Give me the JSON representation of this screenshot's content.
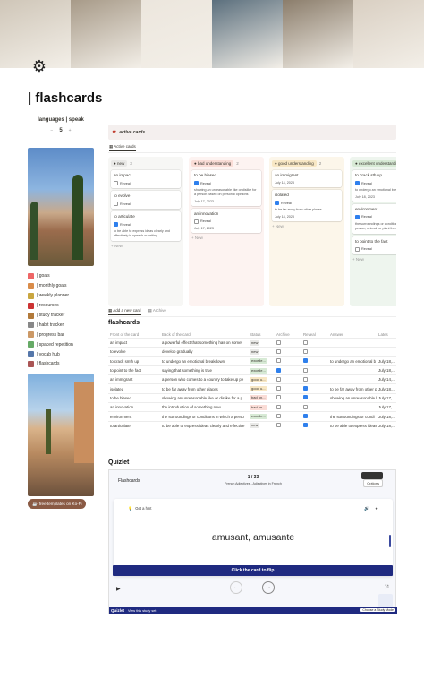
{
  "cover": {
    "colors": [
      "#cfc6b8",
      "#a79a88",
      "#ece6dd",
      "#5b6f7d",
      "#8b7d6b",
      "#d9cfc2"
    ]
  },
  "page": {
    "icon": "gear-icon",
    "title": "| flashcards"
  },
  "languages": {
    "label": "languages | speak",
    "value": "5",
    "dec": "−",
    "inc": "+"
  },
  "nav": [
    {
      "label": "| goals",
      "icon": "target-icon",
      "color": "#e66"
    },
    {
      "label": "| monthly goals",
      "icon": "calendar-icon",
      "color": "#d98c4a"
    },
    {
      "label": "| weekly planner",
      "icon": "planner-icon",
      "color": "#c9a640"
    },
    {
      "label": "| resources",
      "icon": "book-icon",
      "color": "#c33"
    },
    {
      "label": "| study tracker",
      "icon": "pencil-icon",
      "color": "#b27a3a"
    },
    {
      "label": "| habit tracker",
      "icon": "check-icon",
      "color": "#888"
    },
    {
      "label": "| progress bar",
      "icon": "bar-icon",
      "color": "#c96"
    },
    {
      "label": "| spaced repetition",
      "icon": "repeat-icon",
      "color": "#6a6"
    },
    {
      "label": "| vocab hub",
      "icon": "vocab-icon",
      "color": "#57a"
    },
    {
      "label": "| flashcards",
      "icon": "cards-icon",
      "color": "#a55"
    }
  ],
  "kofi": {
    "label": "free templates on Ko-Fi",
    "color": "#8a5a44"
  },
  "active_cards": {
    "title": "active cards",
    "tab": "Active cards"
  },
  "board": [
    {
      "status": "new",
      "count": "3",
      "bg": "#f7f7f5",
      "tagbg": "#e9e9e7",
      "cards": [
        {
          "title": "an impact",
          "reveal": false
        },
        {
          "title": "to evolve",
          "reveal": false
        },
        {
          "title": "to articulate",
          "reveal": true,
          "answer": "to be able to express ideas clearly and effectively in speech or writing"
        }
      ],
      "add": "New"
    },
    {
      "status": "bad understanding",
      "count": "2",
      "bg": "#fdf3f1",
      "tagbg": "#fadcd6",
      "cards": [
        {
          "title": "to be biased",
          "reveal": true,
          "answer": "showing an unreasonable like or dislike for a person based on personal opinions",
          "date": "July 17, 2023"
        },
        {
          "title": "an innovation",
          "reveal": false,
          "date": "July 17, 2023"
        }
      ],
      "add": "New"
    },
    {
      "status": "good understanding",
      "count": "2",
      "bg": "#fcf6ea",
      "tagbg": "#f8e7c4",
      "cards": [
        {
          "title": "an immigrant",
          "date": "July 14, 2023"
        },
        {
          "title": "isolated",
          "reveal": true,
          "answer": "to be far away from other places",
          "date": "July 18, 2023"
        }
      ],
      "add": "New"
    },
    {
      "status": "excellent understanding",
      "count": "",
      "bg": "#eef5ee",
      "tagbg": "#d7ead5",
      "cards": [
        {
          "title": "to crack sth up",
          "reveal": true,
          "answer": "to undergo an emotional breakdown",
          "date": "July 18, 2023"
        },
        {
          "title": "environment",
          "reveal": true,
          "answer": "the surroundings or conditions in which a person, animal, or plant lives"
        },
        {
          "title": "to point to the fact",
          "reveal": false
        }
      ],
      "add": "New"
    }
  ],
  "db": {
    "tab_add": "Add a new card",
    "tab_archive": "Archive",
    "title": "flashcards"
  },
  "table": {
    "headers": [
      "Front of the card",
      "Back of the card",
      "Status",
      "Archive",
      "Reveal",
      "Answer",
      "Lates"
    ],
    "rows": [
      {
        "front": "an impact",
        "back": "a powerful effect that something has on somet",
        "status": "new",
        "sbg": "#e9e9e7",
        "archive": false,
        "reveal": false,
        "answer": "",
        "date": ""
      },
      {
        "front": "to evolve",
        "back": "develop gradually",
        "status": "new",
        "sbg": "#e9e9e7",
        "archive": false,
        "reveal": false,
        "answer": "",
        "date": ""
      },
      {
        "front": "to crack smth up",
        "back": "to undergo an emotional breakdown",
        "status": "excelle...",
        "sbg": "#d7ead5",
        "archive": false,
        "reveal": true,
        "answer": "to undergo an emotional b",
        "date": "July 18,..."
      },
      {
        "front": "to point to the fact",
        "back": "saying that something is true",
        "status": "excelle...",
        "sbg": "#d7ead5",
        "archive": true,
        "reveal": false,
        "answer": "",
        "date": "July 18,..."
      },
      {
        "front": "an immigrant",
        "back": "a person who comes to a country to take up pe",
        "status": "good u...",
        "sbg": "#f8e7c4",
        "archive": false,
        "reveal": false,
        "answer": "",
        "date": "July 14,..."
      },
      {
        "front": "isolated",
        "back": "to be far away from other places",
        "status": "good u...",
        "sbg": "#f8e7c4",
        "archive": false,
        "reveal": true,
        "answer": "to be far away from other p",
        "date": "July 18,..."
      },
      {
        "front": "to be biased",
        "back": "showing an unreasonable like or dislike for a p",
        "status": "bad un...",
        "sbg": "#fadcd6",
        "archive": false,
        "reveal": true,
        "answer": "showing an unreasonable li",
        "date": "July 17,..."
      },
      {
        "front": "an innovation",
        "back": "the introduction of something new",
        "status": "bad un...",
        "sbg": "#fadcd6",
        "archive": false,
        "reveal": false,
        "answer": "",
        "date": "July 17,..."
      },
      {
        "front": "environment",
        "back": "the surroundings or conditions in which a perso",
        "status": "excelle...",
        "sbg": "#d7ead5",
        "archive": false,
        "reveal": true,
        "answer": "the surroundings or condi",
        "date": "July 18,..."
      },
      {
        "front": "to articulate",
        "back": "to be able to express ideas clearly and effective",
        "status": "new",
        "sbg": "#e9e9e7",
        "archive": false,
        "reveal": true,
        "answer": "to be able to express ideas",
        "date": "July 18,..."
      }
    ]
  },
  "quizlet": {
    "label": "Quizlet",
    "deck": "Flashcards",
    "progress": "1 / 33",
    "subtitle": "French Adjectives - Adjectives in French",
    "options": "Options",
    "hint": "Get a hint",
    "word": "amusant, amusante",
    "flip": "Click the card to flip",
    "brand": "Quizlet",
    "view_set": "View this study set",
    "mode": "Choose a Study Mode"
  }
}
